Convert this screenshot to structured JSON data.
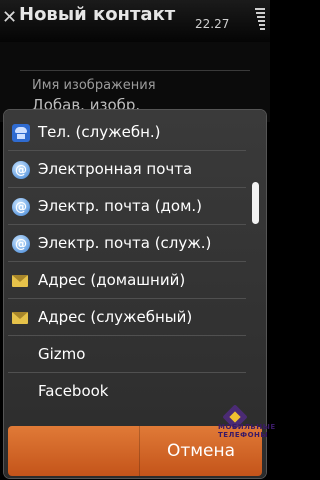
{
  "status_bar": {
    "title": "Новый контакт",
    "time": "22.27"
  },
  "form": {
    "field_label": "Имя изображения",
    "field_value": "Добав. изобр."
  },
  "menu": {
    "items": [
      {
        "label": "Тел. (служебн.)",
        "icon": "phone-icon"
      },
      {
        "label": "Электронная почта",
        "icon": "email-icon"
      },
      {
        "label": "Электр. почта (дом.)",
        "icon": "email-icon"
      },
      {
        "label": "Электр. почта (служ.)",
        "icon": "email-icon"
      },
      {
        "label": "Адрес (домашний)",
        "icon": "envelope-icon"
      },
      {
        "label": "Адрес (служебный)",
        "icon": "envelope-icon"
      },
      {
        "label": "Gizmo",
        "icon": ""
      },
      {
        "label": "Facebook",
        "icon": ""
      }
    ],
    "cancel_label": "Отмена"
  },
  "watermark": {
    "text": "МОБИЛЬНЫЕ ТЕЛЕФОНЫ"
  },
  "colors": {
    "accent_orange": "#d9692c",
    "popup_background": "#333333",
    "list_text": "#ffffff"
  }
}
